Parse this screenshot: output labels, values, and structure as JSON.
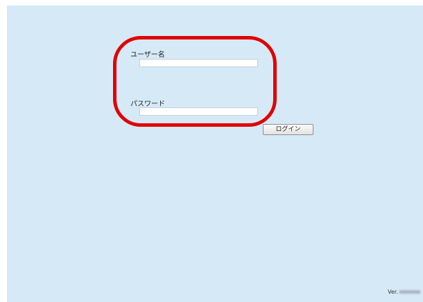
{
  "login_form": {
    "username_label": "ユーザー名",
    "username_value": "",
    "password_label": "パスワード",
    "password_value": "",
    "login_button_label": "ログイン"
  },
  "footer": {
    "version_label": "Ver."
  },
  "annotation": {
    "highlight_color": "#e00000"
  },
  "colors": {
    "background": "#d6e9f6"
  }
}
